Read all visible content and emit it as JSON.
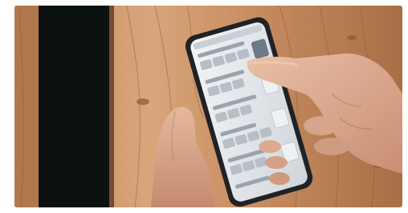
{
  "scene": {
    "subject": "hands-holding-smartphone",
    "setting": "wooden-background",
    "colors": {
      "frame": "#ffffff",
      "wood_light": "#d9a57a",
      "wood_mid": "#b77a4f",
      "wood_dark": "#7a4b2c",
      "doorway_dark": "#0b1210",
      "phone_body": "#202225",
      "screen_bg": "#dfe3e7",
      "screen_card": "#f4f6f8",
      "skin": "#e0b39a",
      "skin_shadow": "#c68f74"
    },
    "phone": {
      "visible_rows": 6,
      "accent": "#6c7a86"
    }
  }
}
